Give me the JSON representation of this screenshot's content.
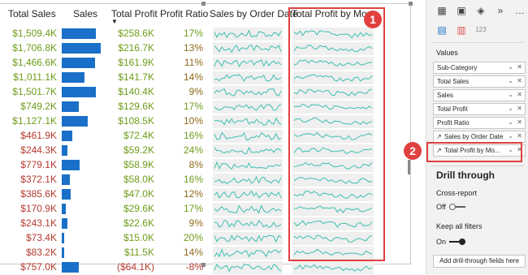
{
  "table": {
    "headers": {
      "total_sales": "Total Sales",
      "sales": "Sales",
      "total_profit": "Total Profit",
      "profit_ratio": "Profit Ratio",
      "sales_by_order_date": "Sales by Order Date",
      "total_profit_by_month": "Total Profit by Mon"
    },
    "rows": [
      {
        "total_sales": "$1,509.4K",
        "sales_bar": 1509.4,
        "total_profit": "$258.6K",
        "profit_ratio": "17%"
      },
      {
        "total_sales": "$1,706.8K",
        "sales_bar": 1706.8,
        "total_profit": "$216.7K",
        "profit_ratio": "13%"
      },
      {
        "total_sales": "$1,466.6K",
        "sales_bar": 1466.6,
        "total_profit": "$161.9K",
        "profit_ratio": "11%"
      },
      {
        "total_sales": "$1,011.1K",
        "sales_bar": 1011.1,
        "total_profit": "$141.7K",
        "profit_ratio": "14%"
      },
      {
        "total_sales": "$1,501.7K",
        "sales_bar": 1501.7,
        "total_profit": "$140.4K",
        "profit_ratio": "9%"
      },
      {
        "total_sales": "$749.2K",
        "sales_bar": 749.2,
        "total_profit": "$129.6K",
        "profit_ratio": "17%"
      },
      {
        "total_sales": "$1,127.1K",
        "sales_bar": 1127.1,
        "total_profit": "$108.5K",
        "profit_ratio": "10%"
      },
      {
        "total_sales": "$461.9K",
        "sales_bar": 461.9,
        "total_profit": "$72.4K",
        "profit_ratio": "16%"
      },
      {
        "total_sales": "$244.3K",
        "sales_bar": 244.3,
        "total_profit": "$59.2K",
        "profit_ratio": "24%"
      },
      {
        "total_sales": "$779.1K",
        "sales_bar": 779.1,
        "total_profit": "$58.9K",
        "profit_ratio": "8%"
      },
      {
        "total_sales": "$372.1K",
        "sales_bar": 372.1,
        "total_profit": "$58.0K",
        "profit_ratio": "16%"
      },
      {
        "total_sales": "$385.6K",
        "sales_bar": 385.6,
        "total_profit": "$47.0K",
        "profit_ratio": "12%"
      },
      {
        "total_sales": "$170.9K",
        "sales_bar": 170.9,
        "total_profit": "$29.6K",
        "profit_ratio": "17%"
      },
      {
        "total_sales": "$243.1K",
        "sales_bar": 243.1,
        "total_profit": "$22.6K",
        "profit_ratio": "9%"
      },
      {
        "total_sales": "$73.4K",
        "sales_bar": 73.4,
        "total_profit": "$15.0K",
        "profit_ratio": "20%"
      },
      {
        "total_sales": "$83.2K",
        "sales_bar": 83.2,
        "total_profit": "$11.5K",
        "profit_ratio": "14%"
      },
      {
        "total_sales": "$757.0K",
        "sales_bar": 757.0,
        "total_profit": "($64.1K)",
        "profit_ratio": "-8%"
      }
    ],
    "bar_max": 1706.8,
    "colors": {
      "sales_text": "#6e9c1a",
      "ratio_text": "#8e6a1a",
      "low_text": "#b53a2f",
      "bar": "#1a70c8",
      "sparkline": "#3cbfb0"
    }
  },
  "badges": {
    "one": "1",
    "two": "2"
  },
  "pane": {
    "visual_icons": [
      "matrix-icon",
      "paint-icon",
      "analytics-icon",
      "chevrons-icon",
      "more-icon",
      "table-visual-icon",
      "grid-icon",
      "123-icon"
    ],
    "values_label": "Values",
    "fields": [
      {
        "label": "Sub-Category",
        "icon": ""
      },
      {
        "label": "Total Sales",
        "icon": ""
      },
      {
        "label": "Sales",
        "icon": ""
      },
      {
        "label": "Total Profit",
        "icon": ""
      },
      {
        "label": "Profit Ratio",
        "icon": ""
      },
      {
        "label": "Sales by Order Date",
        "icon": "sparkline-icon"
      },
      {
        "label": "Total Profit by Mo...",
        "icon": "sparkline-icon"
      }
    ],
    "drill_through": "Drill through",
    "cross_report": "Cross-report",
    "cross_report_state": "Off",
    "keep_all_filters": "Keep all filters",
    "keep_all_filters_state": "On",
    "add_button": "Add drill-through fields here"
  }
}
